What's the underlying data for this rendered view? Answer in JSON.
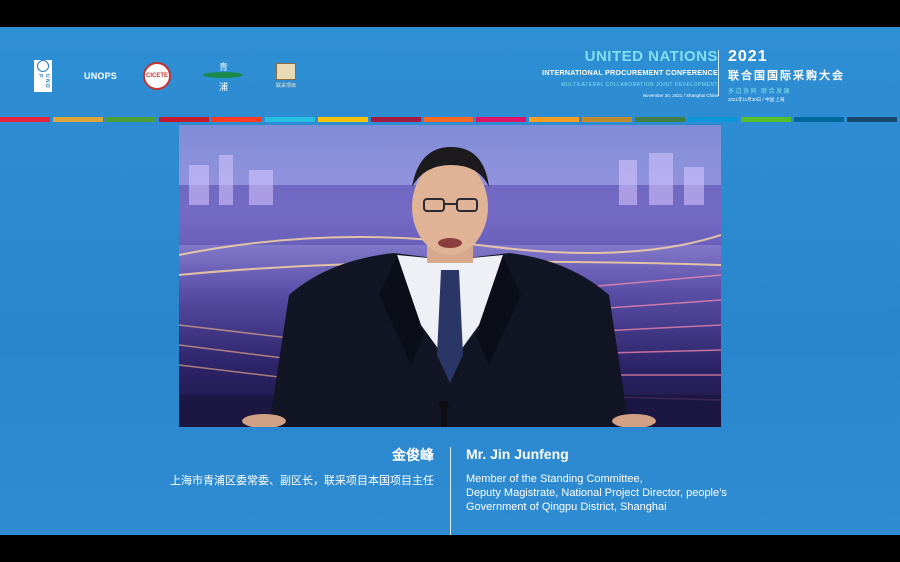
{
  "header": {
    "logos": [
      {
        "name": "undp-logo",
        "text": "U N D P"
      },
      {
        "name": "unops-logo",
        "text": "UNOPS"
      },
      {
        "name": "cicete-logo",
        "text": "CICETE"
      },
      {
        "name": "qingpu-logo",
        "text": "青 浦"
      },
      {
        "name": "seal-logo",
        "text": "联采项目"
      }
    ],
    "conference": {
      "title_en": "UNITED NATIONS",
      "subtitle_en": "INTERNATIONAL PROCUREMENT CONFERENCE",
      "motto_en": "MULTILATERAL COLLABORATION   JOINT DEVELOPMENT",
      "date_en": "November 30, 2021  /  Shanghai China",
      "year": "2021",
      "title_zh": "联合国国际采购大会",
      "motto_zh": "多边协同  联合发展",
      "date_zh": "2021年11月30日 / 中国·上海"
    },
    "strip_colors": [
      "#e5243b",
      "#dda63a",
      "#4c9f38",
      "#c5192d",
      "#ff3a21",
      "#26bde2",
      "#fcc30b",
      "#a21942",
      "#fd6925",
      "#dd1367",
      "#fd9d24",
      "#bf8b2e",
      "#3f7e44",
      "#0a97d9",
      "#56c02b",
      "#00689d",
      "#19486a"
    ]
  },
  "caption": {
    "name_zh": "金俊峰",
    "title_zh": "上海市青浦区委常委、副区长，联采项目本国项目主任",
    "name_en": "Mr. Jin Junfeng",
    "title_en_lines": [
      "Member of the Standing Committee,",
      "Deputy Magistrate, National Project Director, people’s",
      "Government of Qingpu District, Shanghai"
    ]
  },
  "colors": {
    "background": "#2a86cc",
    "accent": "#7fe0f0",
    "text": "#ffffff"
  }
}
